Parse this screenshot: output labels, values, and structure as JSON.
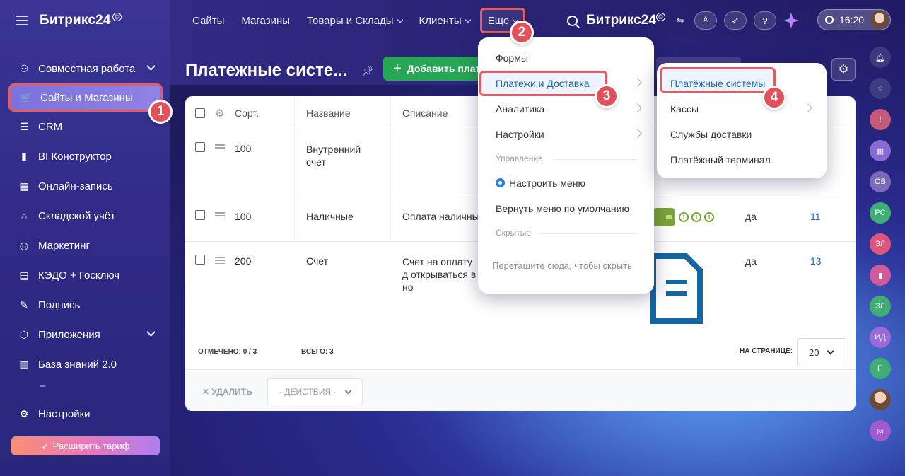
{
  "app": {
    "logo": "Битрикс24",
    "logo_mark": "©"
  },
  "sidebar": {
    "items": [
      {
        "label": "Совместная работа",
        "icon": "collaboration-icon",
        "expandable": true
      },
      {
        "label": "Сайты и Магазины",
        "icon": "cart-icon",
        "active": true
      },
      {
        "label": "CRM",
        "icon": "crm-icon"
      },
      {
        "label": "BI Конструктор",
        "icon": "bar-chart-icon"
      },
      {
        "label": "Онлайн-запись",
        "icon": "calendar-booking-icon"
      },
      {
        "label": "Складской учёт",
        "icon": "warehouse-icon"
      },
      {
        "label": "Маркетинг",
        "icon": "target-icon"
      },
      {
        "label": "КЭДО + Госключ",
        "icon": "document-key-icon"
      },
      {
        "label": "Подпись",
        "icon": "pen-icon"
      },
      {
        "label": "Приложения",
        "icon": "cube-icon",
        "expandable": true
      },
      {
        "label": "База знаний 2.0",
        "icon": "books-icon"
      }
    ],
    "separator": "–",
    "settings": "Настройки",
    "upgrade": "Расширить тариф"
  },
  "topnav": {
    "items": [
      "Сайты",
      "Магазины",
      "Товары и Склады",
      "Клиенты",
      "Еще"
    ],
    "brand": "Битрикс24",
    "time": "16:20"
  },
  "page": {
    "title": "Платежные систе...",
    "add_button": "Добавить платежную систему"
  },
  "table": {
    "columns": [
      "Сорт.",
      "Название",
      "Описание"
    ],
    "rows": [
      {
        "sort": "100",
        "name": "Внутренний счет",
        "description": "",
        "active": "",
        "id": ""
      },
      {
        "sort": "100",
        "name": "Наличные",
        "description": "Оплата наличны",
        "active": "да",
        "id": "11"
      },
      {
        "sort": "200",
        "name": "Счет",
        "description": "Счет на оплату д открываться в но",
        "active": "да",
        "id": "13"
      }
    ],
    "footer": {
      "marked_label": "ОТМЕЧЕНО:",
      "marked_value": "0 / 3",
      "total_label": "ВСЕГО:",
      "total_value": "3",
      "per_page_label": "НА СТРАНИЦЕ:",
      "per_page_value": "20"
    },
    "actions": {
      "delete": "УДАЛИТЬ",
      "select": "- ДЕЙСТВИЯ -"
    }
  },
  "menu_more": {
    "items": [
      {
        "label": "Формы"
      },
      {
        "label": "Платежи и Доставка",
        "submenu": true,
        "highlighted": true
      },
      {
        "label": "Аналитика",
        "submenu": true
      },
      {
        "label": "Настройки",
        "submenu": true
      }
    ],
    "group_manage": "Управление",
    "configure": "Настроить меню",
    "reset": "Вернуть меню по умолчанию",
    "group_hidden": "Скрытые",
    "drop_hint": "Перетащите сюда, чтобы скрыть"
  },
  "submenu_payments": {
    "items": [
      {
        "label": "Платёжные системы",
        "highlighted": true
      },
      {
        "label": "Кассы",
        "submenu": true
      },
      {
        "label": "Службы доставки"
      },
      {
        "label": "Платёжный терминал"
      }
    ]
  },
  "rail": {
    "avatars": [
      "ОВ",
      "РС",
      "ЗЛ",
      "ЗЛ",
      "ИД",
      "П"
    ]
  },
  "badges": [
    "1",
    "2",
    "3",
    "4"
  ],
  "colors": {
    "accent_red": "#e65b63",
    "add_green": "#27a655",
    "link_blue": "#2067b0"
  }
}
